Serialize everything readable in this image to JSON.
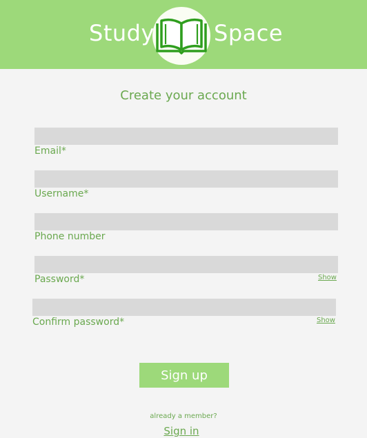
{
  "header": {
    "brand_left": "Study",
    "brand_right": "Space",
    "logo_icon": "open-book-icon",
    "background_color": "#9dd97a"
  },
  "form": {
    "title": "Create your account",
    "fields": {
      "email": {
        "label": "Email*",
        "value": ""
      },
      "username": {
        "label": "Username*",
        "value": ""
      },
      "phone": {
        "label": "Phone number",
        "value": ""
      },
      "password": {
        "label": "Password*",
        "value": "",
        "show_label": "Show"
      },
      "confirm_password": {
        "label": "Confirm password*",
        "value": "",
        "show_label": "Show"
      }
    },
    "submit_label": "Sign up"
  },
  "footer": {
    "member_prompt": "already a member?",
    "signin_label": "Sign in"
  },
  "colors": {
    "accent": "#9dd97a",
    "text_green": "#6aa84f",
    "field_bg": "#d9d9d9",
    "page_bg": "#f4f4f4"
  }
}
